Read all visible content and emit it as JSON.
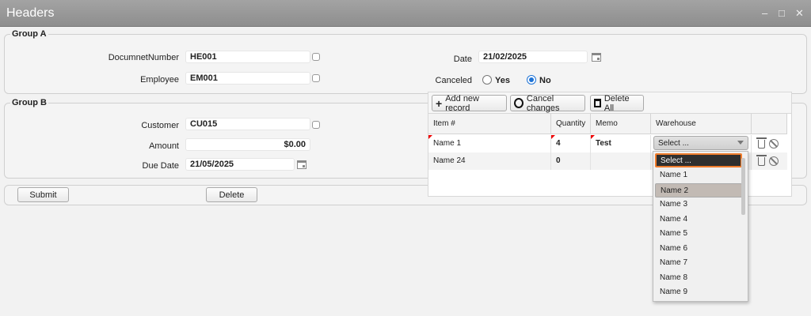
{
  "window": {
    "title": "Headers",
    "minimize": "–",
    "maximize": "□",
    "close": "✕"
  },
  "group_a": {
    "label": "Group A",
    "document_number": {
      "label": "DocumnetNumber",
      "value": "HE001"
    },
    "employee": {
      "label": "Employee",
      "value": "EM001"
    },
    "date": {
      "label": "Date",
      "value": "21/02/2025"
    },
    "canceled": {
      "label": "Canceled",
      "yes": "Yes",
      "no": "No",
      "selected": "No"
    }
  },
  "group_b": {
    "label": "Group B",
    "customer": {
      "label": "Customer",
      "value": "CU015"
    },
    "amount": {
      "label": "Amount",
      "value": "$0.00"
    },
    "due_date": {
      "label": "Due Date",
      "value": "21/05/2025"
    }
  },
  "actions": {
    "submit": "Submit",
    "delete": "Delete"
  },
  "grid": {
    "toolbar": {
      "add": "Add new record",
      "cancel": "Cancel changes",
      "delete_all": "Delete All"
    },
    "columns": [
      "Item #",
      "Quantity",
      "Memo",
      "Warehouse"
    ],
    "rows": [
      {
        "item": "Name 1",
        "quantity": "4",
        "memo": "Test",
        "warehouse": "Select ..."
      },
      {
        "item": "Name 24",
        "quantity": "0",
        "memo": "",
        "warehouse": ""
      }
    ]
  },
  "warehouse_dropdown": {
    "selected": "Select ...",
    "hovered": "Name 2",
    "options": [
      "Select ...",
      "Name 1",
      "Name 2",
      "Name 3",
      "Name 4",
      "Name 5",
      "Name 6",
      "Name 7",
      "Name 8",
      "Name 9"
    ]
  },
  "colors": {
    "titlebar": "#999999",
    "radio_accent": "#1e73d6",
    "dropdown_focus": "#f07d2d",
    "dirty_marker": "#ee0000"
  },
  "icons": [
    "minimize-icon",
    "maximize-icon",
    "close-icon",
    "checkbox-icon",
    "calendar-icon",
    "plus-icon",
    "cancel-icon",
    "trash-icon"
  ]
}
